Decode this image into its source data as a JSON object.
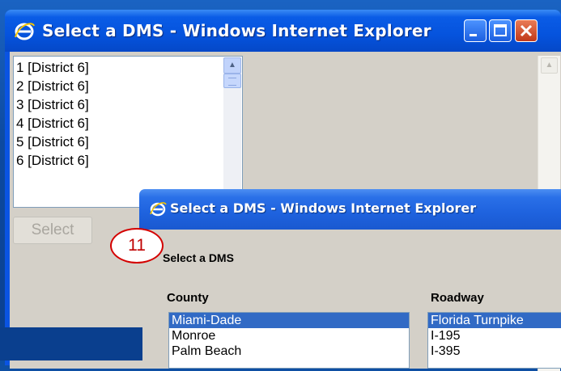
{
  "window1": {
    "title": "Select a DMS - Windows Internet Explorer",
    "list_items": [
      "1 [District 6]",
      "2 [District 6]",
      "3 [District 6]",
      "4 [District 6]",
      "5 [District 6]",
      "6 [District 6]"
    ],
    "select_button": "Select"
  },
  "window2": {
    "title": "Select a DMS - Windows Internet Explorer",
    "heading": "Select a DMS",
    "county_label": "County",
    "roadway_label": "Roadway",
    "county_options": [
      "Miami-Dade",
      "Monroe",
      "Palm Beach"
    ],
    "county_selected": "Miami-Dade",
    "roadway_options": [
      "Florida Turnpike",
      "I-195",
      "I-395"
    ],
    "roadway_selected": "Florida Turnpike"
  },
  "step_badge": "11",
  "icons": {
    "browser": "ie-logo-icon",
    "minimize": "minimize-icon",
    "maximize": "maximize-icon",
    "close": "close-icon"
  },
  "colors": {
    "titlebar": "#0553dd",
    "client": "#d4d0c8",
    "selection": "#316ac5",
    "badge": "#d40000"
  }
}
